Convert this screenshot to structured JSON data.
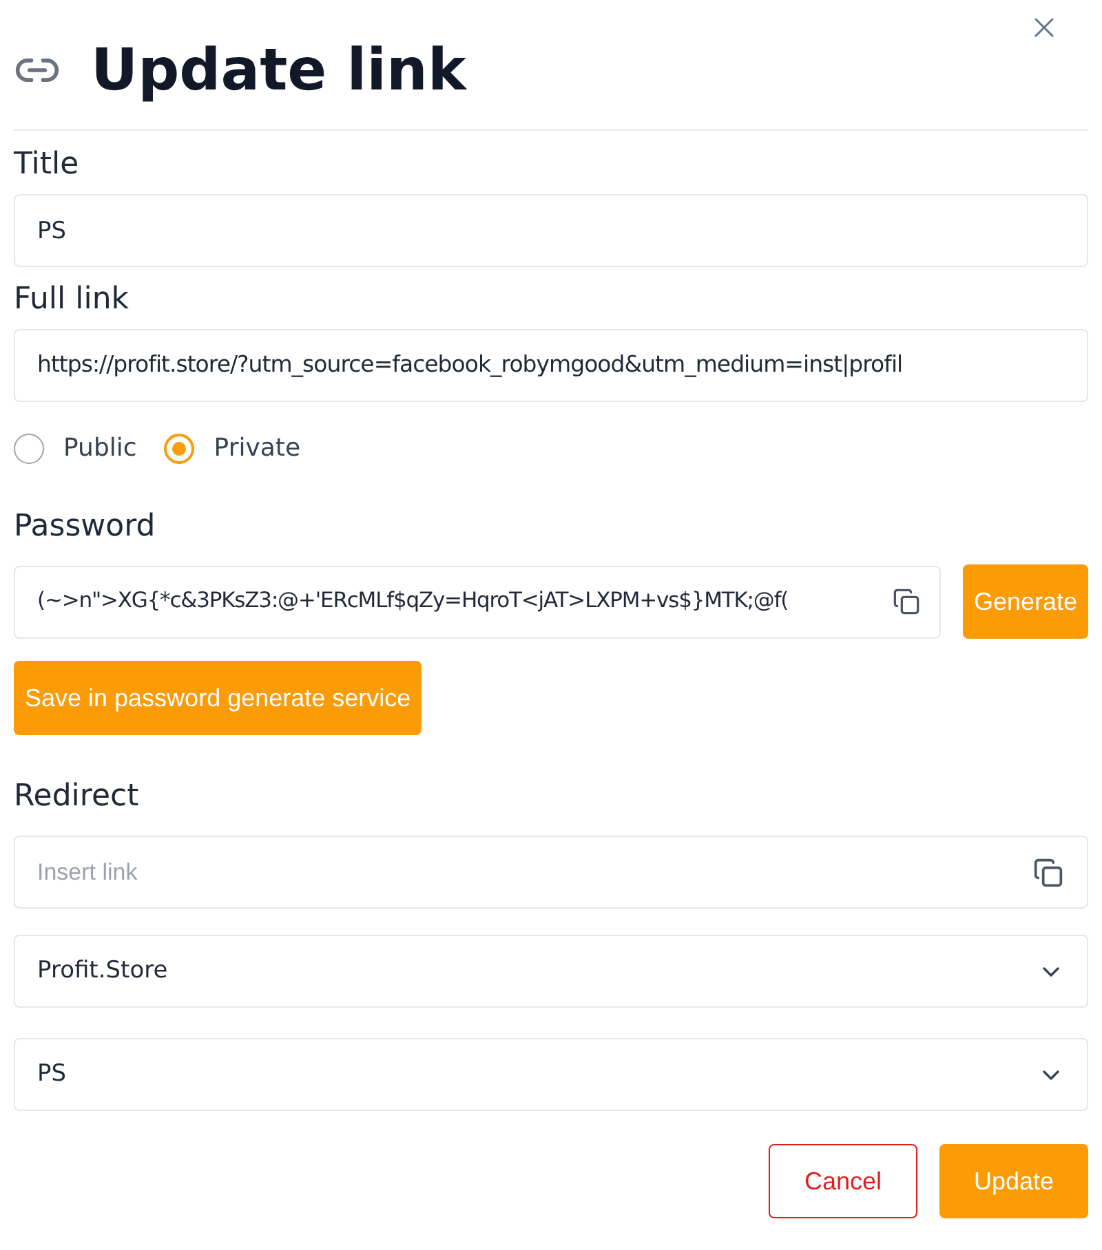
{
  "dialog": {
    "title": "Update link"
  },
  "title_field": {
    "label": "Title",
    "value": "PS"
  },
  "link_field": {
    "label": "Full link",
    "value": "https://profit.store/?utm_source=facebook_robymgood&utm_medium=inst|profil"
  },
  "visibility": [
    {
      "label": "Public",
      "selected": false
    },
    {
      "label": "Private",
      "selected": true
    }
  ],
  "password": {
    "label": "Password",
    "value": "(~>n\">XG{*c&3PKsZ3:@+'ERcMLf$qZy=HqroT<jAT>LXPM+vs$}MTK;@f(",
    "generate": "Generate",
    "save": "Save in password generate service"
  },
  "redirect": {
    "label": "Redirect",
    "placeholder": "Insert link",
    "selects": [
      "Profit.Store",
      "PS"
    ]
  },
  "buttons": {
    "cancel": "Cancel",
    "update": "Update"
  }
}
